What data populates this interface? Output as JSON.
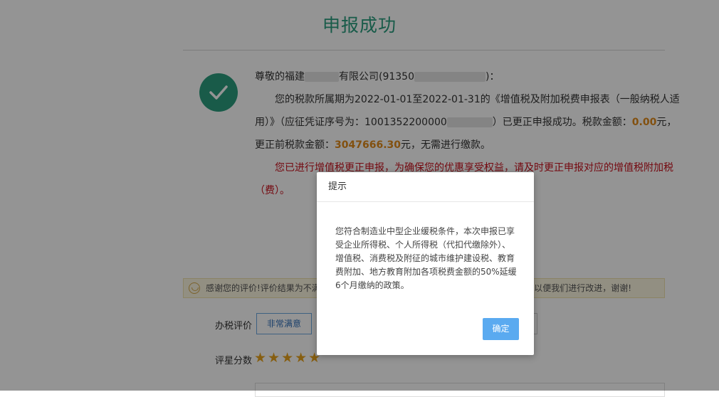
{
  "page": {
    "title": "申报成功",
    "greeting_prefix": "尊敬的福建",
    "greeting_mid": "有限公司(91350",
    "greeting_suffix": ")：",
    "line2_a": "您的税款所属期为2022-01-01至2022-01-31的《增值税及附加税费申报表（一般纳税人适",
    "line3_a": "用）》（应征凭证序号为：1001352200000",
    "line3_b": "）已更正申报成功。税款金额：",
    "line3_amount": "0.00",
    "line3_c": "元，",
    "line4_a": "更正前税款金额：",
    "line4_amount": "3047666.30",
    "line4_b": "元，无需进行缴款。",
    "red_line1": "您已进行增值税更正申报，为确保您的优惠享受权益，请及时更正申报对应的增值税附加税",
    "red_line2": "（费）。"
  },
  "notice": {
    "left_text": "感谢您的评价!评价结果为不满",
    "right_text": "以便我们进行改进，谢谢!"
  },
  "rating": {
    "label": "办税评价",
    "option": "非常满意",
    "score_label": "评星分数",
    "stars": "★★★★★",
    "star_count": 5
  },
  "dialog": {
    "title": "提示",
    "body_lines": [
      "您符合制造业中型企业缓税条件，本次申报已享",
      "受企业所得税、个人所得税（代扣代缴除外）、",
      "增值税、消费税及附征的城市维护建设税、教育",
      "费附加、地方教育附加各项税费金额的50%延缓",
      "6个月缴纳的政策。"
    ],
    "confirm_label": "确定"
  },
  "colors": {
    "title_green": "#2a9d7f",
    "amount_orange": "#e08b1a",
    "warning_red": "#c9101c",
    "confirm_blue": "#5aaaf0"
  }
}
